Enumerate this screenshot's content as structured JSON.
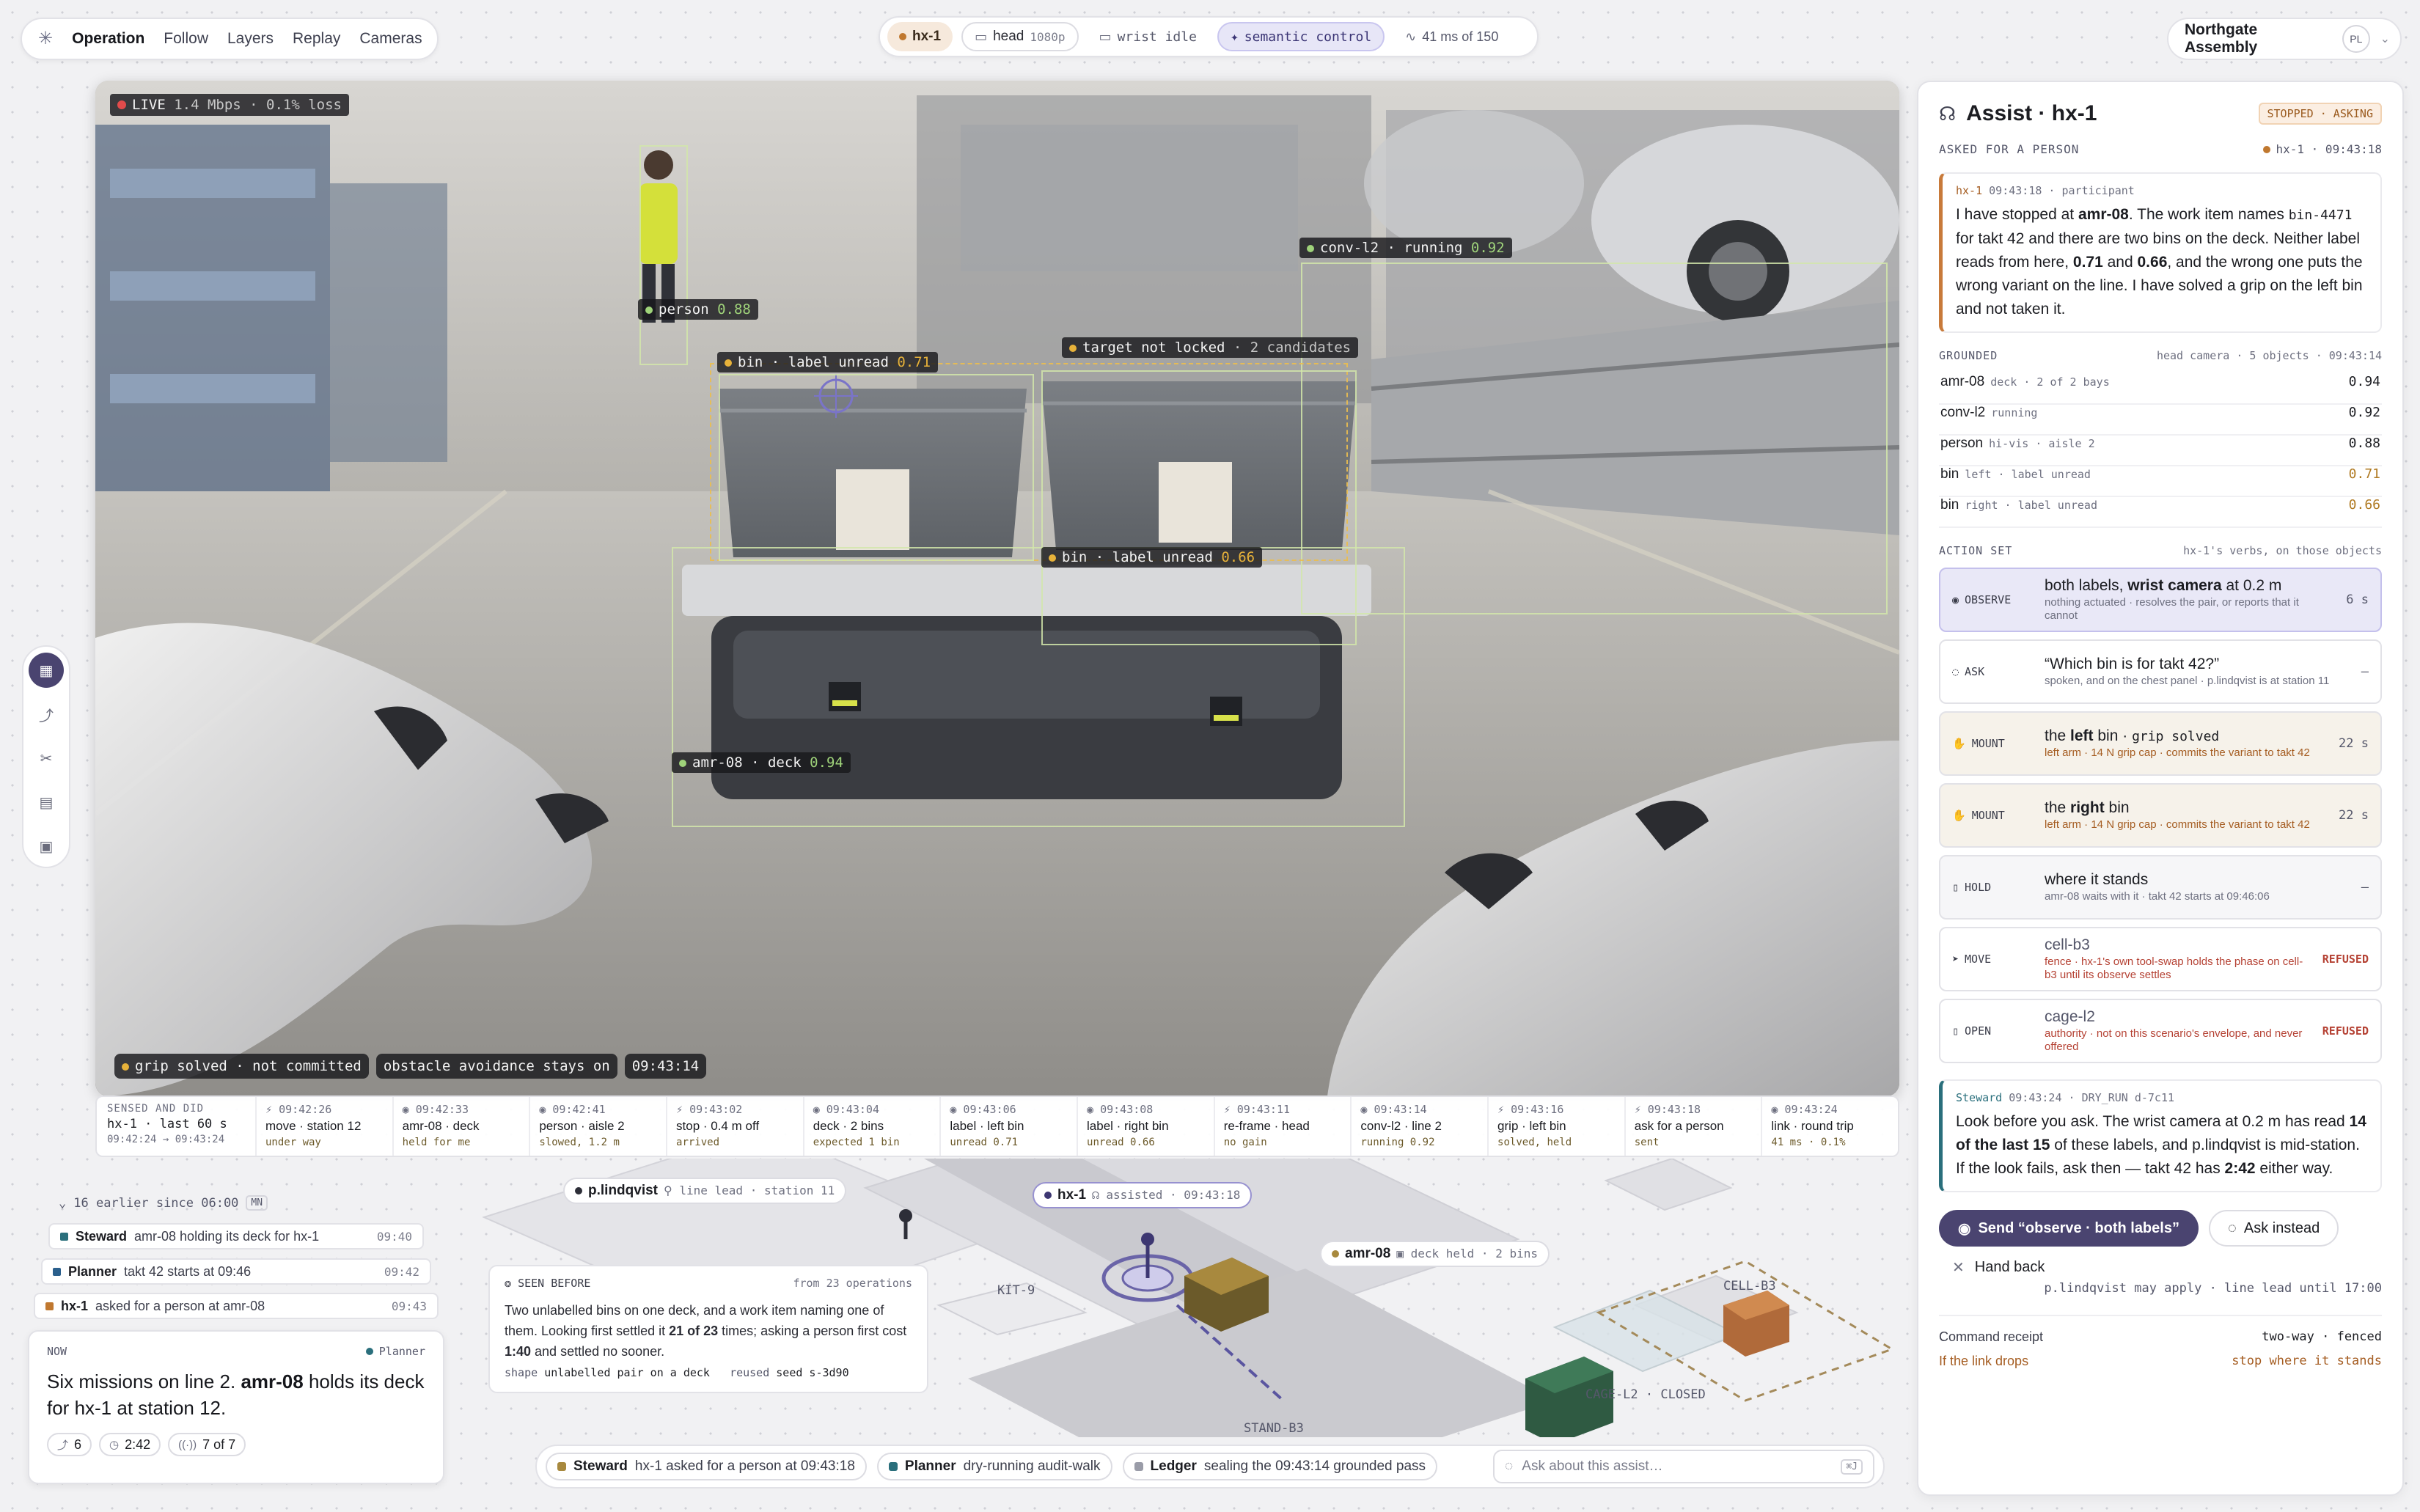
{
  "topnav": {
    "items": [
      "Operation",
      "Follow",
      "Layers",
      "Replay",
      "Cameras"
    ]
  },
  "context": {
    "robot": "hx-1",
    "head_cam": "head",
    "head_res": "1080p",
    "wrist_cam": "wrist idle",
    "mode": "semantic control",
    "latency": "41 ms of 150"
  },
  "site": {
    "name": "Northgate Assembly",
    "avatar": "PL"
  },
  "feed": {
    "live": "LIVE",
    "bitrate": "1.4 Mbps · 0.1% loss",
    "labels": {
      "person": "person",
      "person_conf": "0.88",
      "conv": "conv-l2 · running",
      "conv_conf": "0.92",
      "target": "target not locked",
      "target_sub": "· 2 candidates",
      "bin_left": "bin · label unread",
      "bin_left_conf": "0.71",
      "bin_right": "bin · label unread",
      "bin_right_conf": "0.66",
      "amr": "amr-08 · deck",
      "amr_conf": "0.94"
    },
    "status": [
      "grip solved · not committed",
      "obstacle avoidance stays on",
      "09:43:14"
    ]
  },
  "timeline": {
    "head_k": "SENSED AND DID",
    "head_v": "hx-1 · last 60 s",
    "head_s": "09:42:24 → 09:43:24",
    "events": [
      {
        "t": "09:42:26",
        "a": "move · station 12",
        "r": "under way"
      },
      {
        "t": "09:42:33",
        "a": "amr-08 · deck",
        "r": "held for me"
      },
      {
        "t": "09:42:41",
        "a": "person · aisle 2",
        "r": "slowed, 1.2 m"
      },
      {
        "t": "09:43:02",
        "a": "stop · 0.4 m off",
        "r": "arrived"
      },
      {
        "t": "09:43:04",
        "a": "deck · 2 bins",
        "r": "expected 1 bin"
      },
      {
        "t": "09:43:06",
        "a": "label · left bin",
        "r": "unread 0.71"
      },
      {
        "t": "09:43:08",
        "a": "label · right bin",
        "r": "unread 0.66"
      },
      {
        "t": "09:43:11",
        "a": "re-frame · head",
        "r": "no gain"
      },
      {
        "t": "09:43:14",
        "a": "conv-l2 · line 2",
        "r": "running 0.92"
      },
      {
        "t": "09:43:16",
        "a": "grip · left bin",
        "r": "solved, held"
      },
      {
        "t": "09:43:18",
        "a": "ask for a person",
        "r": "sent"
      },
      {
        "t": "09:43:24",
        "a": "link · round trip",
        "r": "41 ms · 0.1%"
      }
    ]
  },
  "map": {
    "lindqvist_name": "p.lindqvist",
    "lindqvist_role": "line lead · station 11",
    "hx1_name": "hx-1",
    "hx1_state": "assisted · 09:43:18",
    "amr_name": "amr-08",
    "amr_state": "deck held · 2 bins",
    "zones": [
      "KIT-9",
      "CELL-B3",
      "CAGE-L2 · CLOSED",
      "STAND-B3"
    ]
  },
  "left_feed": {
    "earlier": "16 earlier since 06:00",
    "earlier_key": "MN",
    "items": [
      {
        "who": "Steward",
        "msg": "amr-08 holding its deck for hx-1",
        "tm": "09:40",
        "color": "#2a6f7c"
      },
      {
        "who": "Planner",
        "msg": "takt 42 starts at 09:46",
        "tm": "09:42",
        "color": "#2a5f8c"
      },
      {
        "who": "hx-1",
        "msg": "asked for a person at amr-08",
        "tm": "09:43",
        "color": "#c0782f"
      }
    ]
  },
  "now": {
    "label": "NOW",
    "source": "Planner",
    "text_a": "Six missions on line 2. ",
    "text_b": "amr-08",
    "text_c": " holds its deck for hx-1 at station 12.",
    "p1": "6",
    "p2": "2:42",
    "p3": "7 of 7"
  },
  "seen": {
    "label": "SEEN BEFORE",
    "source": "from 23 operations",
    "t1": "Two unlabelled bins on one deck, and a work item naming one of them. Looking first settled it ",
    "t2": "21 of 23",
    "t3": " times; asking a person first cost ",
    "t4": "1:40",
    "t5": " and settled no sooner.",
    "shape_k": "shape",
    "shape_v": "unlabelled pair on a deck",
    "reused_k": "reused",
    "reused_v": "seed s-3d90"
  },
  "bottom": {
    "steward_who": "Steward",
    "steward_msg": "hx-1 asked for a person at 09:43:18",
    "planner_who": "Planner",
    "planner_msg": "dry-running audit-walk",
    "ledger_who": "Ledger",
    "ledger_msg": "sealing the 09:43:14 grounded pass",
    "ask_placeholder": "Ask about this assist…",
    "ask_key": "⌘J"
  },
  "panel": {
    "title": "Assist · hx-1",
    "badge": "STOPPED · ASKING",
    "sub_l": "ASKED FOR A PERSON",
    "sub_r": "hx-1 · 09:43:18",
    "msg_who": "hx-1",
    "msg_meta": "09:43:18 · participant",
    "msg_1": "I have stopped at ",
    "msg_2": "amr-08",
    "msg_3": ". The work item names ",
    "msg_4": "bin-4471",
    "msg_5": " for takt 42 and there are two bins on the deck. Neither label reads from here, ",
    "msg_6": "0.71",
    "msg_7": " and ",
    "msg_8": "0.66",
    "msg_9": ", and the wrong one puts the wrong variant on the line. I have solved a grip on the left bin and not taken it.",
    "grounded_k": "GROUNDED",
    "grounded_r": "head camera · 5 objects · 09:43:14",
    "grounded": [
      {
        "n": "amr-08",
        "d": "deck · 2 of 2 bays",
        "c": "0.94",
        "low": false
      },
      {
        "n": "conv-l2",
        "d": "running",
        "c": "0.92",
        "low": false
      },
      {
        "n": "person",
        "d": "hi-vis · aisle 2",
        "c": "0.88",
        "low": false
      },
      {
        "n": "bin",
        "d": "left · label unread",
        "c": "0.71",
        "low": true
      },
      {
        "n": "bin",
        "d": "right · label unread",
        "c": "0.66",
        "low": true
      }
    ],
    "actions_k": "ACTION SET",
    "actions_r": "hx-1's verbs, on those objects",
    "actions": [
      {
        "kind": "OBSERVE",
        "h": "both labels, wrist camera at 0.2 m",
        "sub": "nothing actuated · resolves the pair, or reports that it cannot",
        "right": "6 s"
      },
      {
        "kind": "ASK",
        "h": "“Which bin is for takt 42?”",
        "sub": "spoken, and on the chest panel · p.lindqvist is at station 11",
        "right": "–"
      },
      {
        "kind": "MOUNT",
        "h": "the left bin · grip solved",
        "sub": "left arm · 14 N grip cap · commits the variant to takt 42",
        "right": "22 s"
      },
      {
        "kind": "MOUNT",
        "h": "the right bin",
        "sub": "left arm · 14 N grip cap · commits the variant to takt 42",
        "right": "22 s"
      },
      {
        "kind": "HOLD",
        "h": "where it stands",
        "sub": "amr-08 waits with it · takt 42 starts at 09:46:06",
        "right": "–"
      },
      {
        "kind": "MOVE",
        "h": "cell-b3",
        "sub": "fence · hx-1's own tool-swap holds the phase on cell-b3 until its observe settles",
        "right": "REFUSED"
      },
      {
        "kind": "OPEN",
        "h": "cage-l2",
        "sub": "authority · not on this scenario's envelope, and never offered",
        "right": "REFUSED"
      }
    ],
    "act3_a": "the ",
    "act3_b": "left",
    "act3_c": " bin · ",
    "act3_d": "grip solved",
    "act4_a": "the ",
    "act4_b": "right",
    "act4_c": " bin",
    "act1_a": "both labels, ",
    "act1_b": "wrist camera",
    "act1_c": " at 0.2 m",
    "steward_who": "Steward",
    "steward_meta": "09:43:24 · DRY_RUN d-7c11",
    "st_1": "Look before you ask. The wrist camera at 0.2 m has read ",
    "st_2": "14 of the last 15",
    "st_3": " of these labels, and p.lindqvist is mid-station. If the look fails, ask then — takt 42 has ",
    "st_4": "2:42",
    "st_5": " either way.",
    "send": "Send “observe · both labels”",
    "ask_instead": "Ask instead",
    "hand_back": "Hand back",
    "apply_note": "p.lindqvist may apply · line lead until 17:00",
    "receipt_k": "Command receipt",
    "receipt_v": "two-way · fenced",
    "drops_k": "If the link drops",
    "drops_v": "stop where it stands"
  }
}
